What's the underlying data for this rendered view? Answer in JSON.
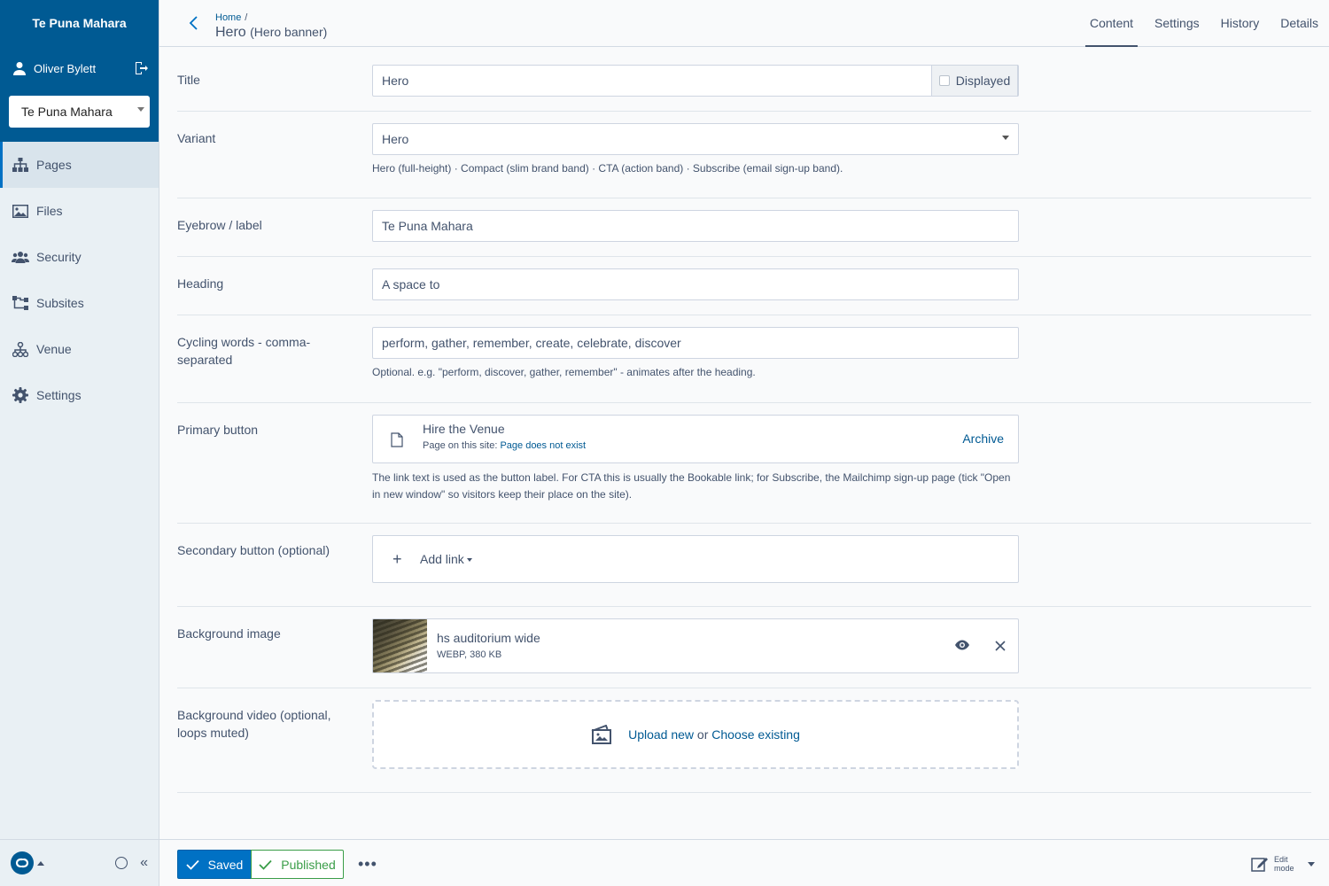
{
  "sidebar": {
    "brand": "Te Puna Mahara",
    "user_name": "Oliver Bylett",
    "subsite": "Te Puna Mahara",
    "items": [
      {
        "label": "Pages",
        "icon": "sitemap-icon",
        "active": true
      },
      {
        "label": "Files",
        "icon": "image-icon",
        "active": false
      },
      {
        "label": "Security",
        "icon": "users-icon",
        "active": false
      },
      {
        "label": "Subsites",
        "icon": "subsites-icon",
        "active": false
      },
      {
        "label": "Venue",
        "icon": "venue-icon",
        "active": false
      },
      {
        "label": "Settings",
        "icon": "gear-icon",
        "active": false
      }
    ],
    "collapse_symbol": "«"
  },
  "header": {
    "breadcrumb_home": "Home",
    "breadcrumb_sep": "/",
    "title": "Hero",
    "title_type": "(Hero banner)",
    "tabs": [
      "Content",
      "Settings",
      "History",
      "Details"
    ],
    "active_tab": "Content"
  },
  "form": {
    "title": {
      "label": "Title",
      "value": "Hero",
      "displayed_label": "Displayed",
      "displayed_checked": false
    },
    "variant": {
      "label": "Variant",
      "value": "Hero",
      "help": "Hero (full-height) · Compact (slim brand band) · CTA (action band) · Subscribe (email sign-up band)."
    },
    "eyebrow": {
      "label": "Eyebrow / label",
      "value": "Te Puna Mahara"
    },
    "heading": {
      "label": "Heading",
      "value": "A space to"
    },
    "cycling": {
      "label_line1": "Cycling words - comma-",
      "label_line2": "separated",
      "value": "perform, gather, remember, create, celebrate, discover",
      "help": "Optional. e.g. \"perform, discover, gather, remember\" - animates after the heading."
    },
    "primary_button": {
      "label": "Primary button",
      "link_title": "Hire the Venue",
      "link_sub_prefix": "Page on this site:",
      "link_sub_status": "Page does not exist",
      "archive_label": "Archive",
      "help_line1": "The link text is used as the button label. For CTA this is usually the Bookable link; for Subscribe, the Mailchimp sign-up page (tick \"Open",
      "help_line2": "in new window\" so visitors keep their place on the site)."
    },
    "secondary_button": {
      "label": "Secondary button (optional)",
      "plus": "+",
      "add_label": "Add link"
    },
    "background_image": {
      "label": "Background image",
      "name": "hs auditorium wide",
      "meta": "WEBP, 380 KB"
    },
    "background_video": {
      "label_line1": "Background video (optional,",
      "label_line2": "loops muted)",
      "upload_new": "Upload new",
      "or": "or",
      "choose_existing": "Choose existing"
    }
  },
  "actions": {
    "saved_label": "Saved",
    "published_label": "Published",
    "more_label": "•••",
    "edit_mode_line1": "Edit",
    "edit_mode_line2": "mode"
  },
  "colors": {
    "brand": "#005a93",
    "accent": "#0071c4",
    "published_green": "#3a9d48",
    "text": "#43536d"
  }
}
